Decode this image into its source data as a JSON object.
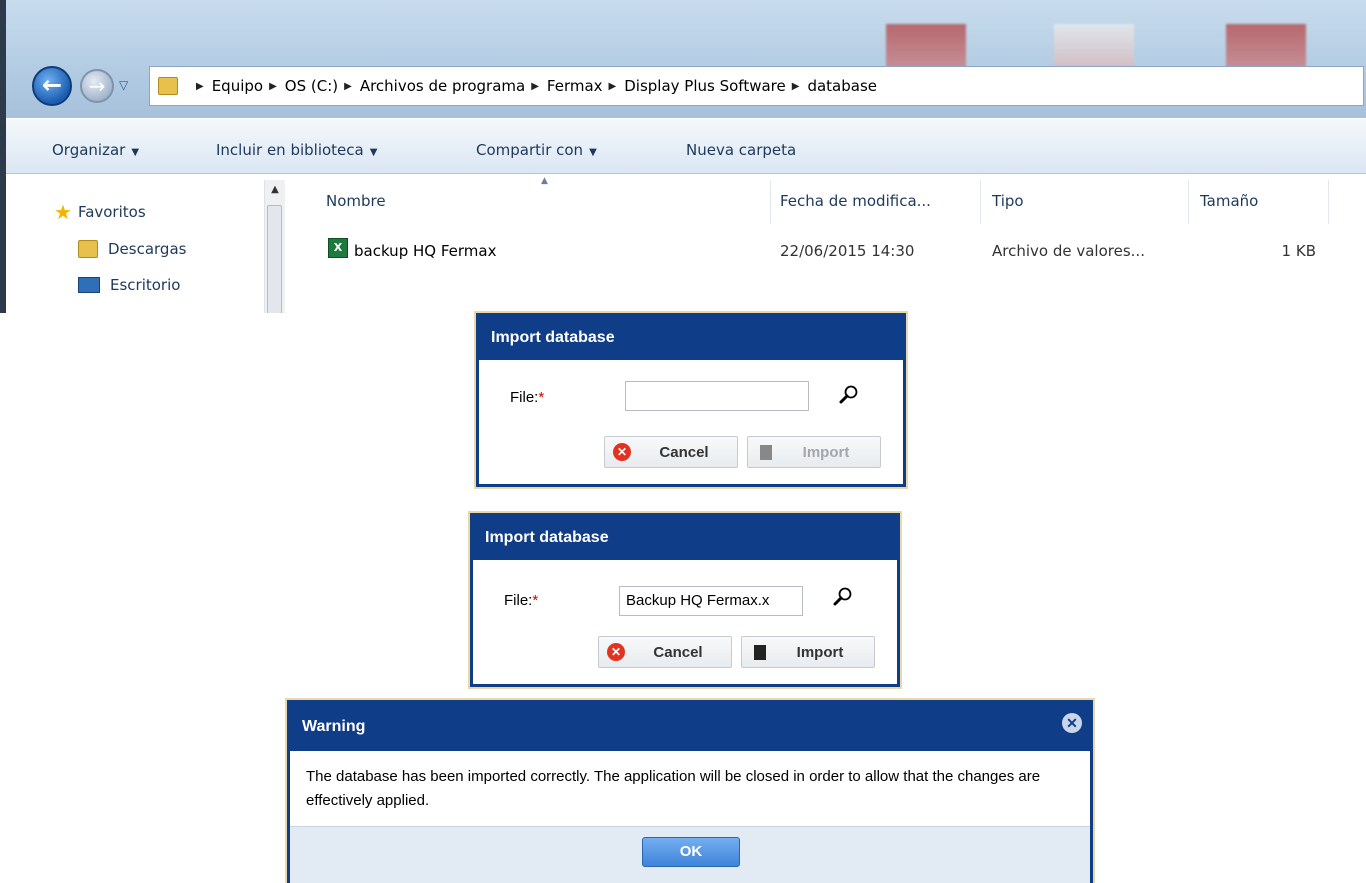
{
  "explorer": {
    "breadcrumbs": [
      "Equipo",
      "OS (C:)",
      "Archivos de programa",
      "Fermax",
      "Display Plus Software",
      "database"
    ],
    "toolbar": {
      "organize": "Organizar",
      "include_library": "Incluir en biblioteca",
      "share_with": "Compartir con",
      "new_folder": "Nueva carpeta"
    },
    "sidebar": {
      "favorites": "Favoritos",
      "items": [
        "Descargas",
        "Escritorio"
      ]
    },
    "columns": {
      "name": "Nombre",
      "modified": "Fecha de modifica...",
      "type": "Tipo",
      "size": "Tamaño"
    },
    "files": [
      {
        "name": "backup HQ Fermax",
        "modified": "22/06/2015 14:30",
        "type": "Archivo de valores...",
        "size": "1 KB"
      }
    ]
  },
  "import_dialog_empty": {
    "title": "Import database",
    "file_label": "File:",
    "required_mark": "*",
    "file_value": "",
    "cancel_label": "Cancel",
    "import_label": "Import"
  },
  "import_dialog_filled": {
    "title": "Import database",
    "file_label": "File:",
    "required_mark": "*",
    "file_value": "Backup HQ Fermax.x",
    "cancel_label": "Cancel",
    "import_label": "Import"
  },
  "warning_dialog": {
    "title": "Warning",
    "message": "The database has been imported correctly. The application will be closed in order to allow that the changes are effectively applied.",
    "ok_label": "OK"
  }
}
